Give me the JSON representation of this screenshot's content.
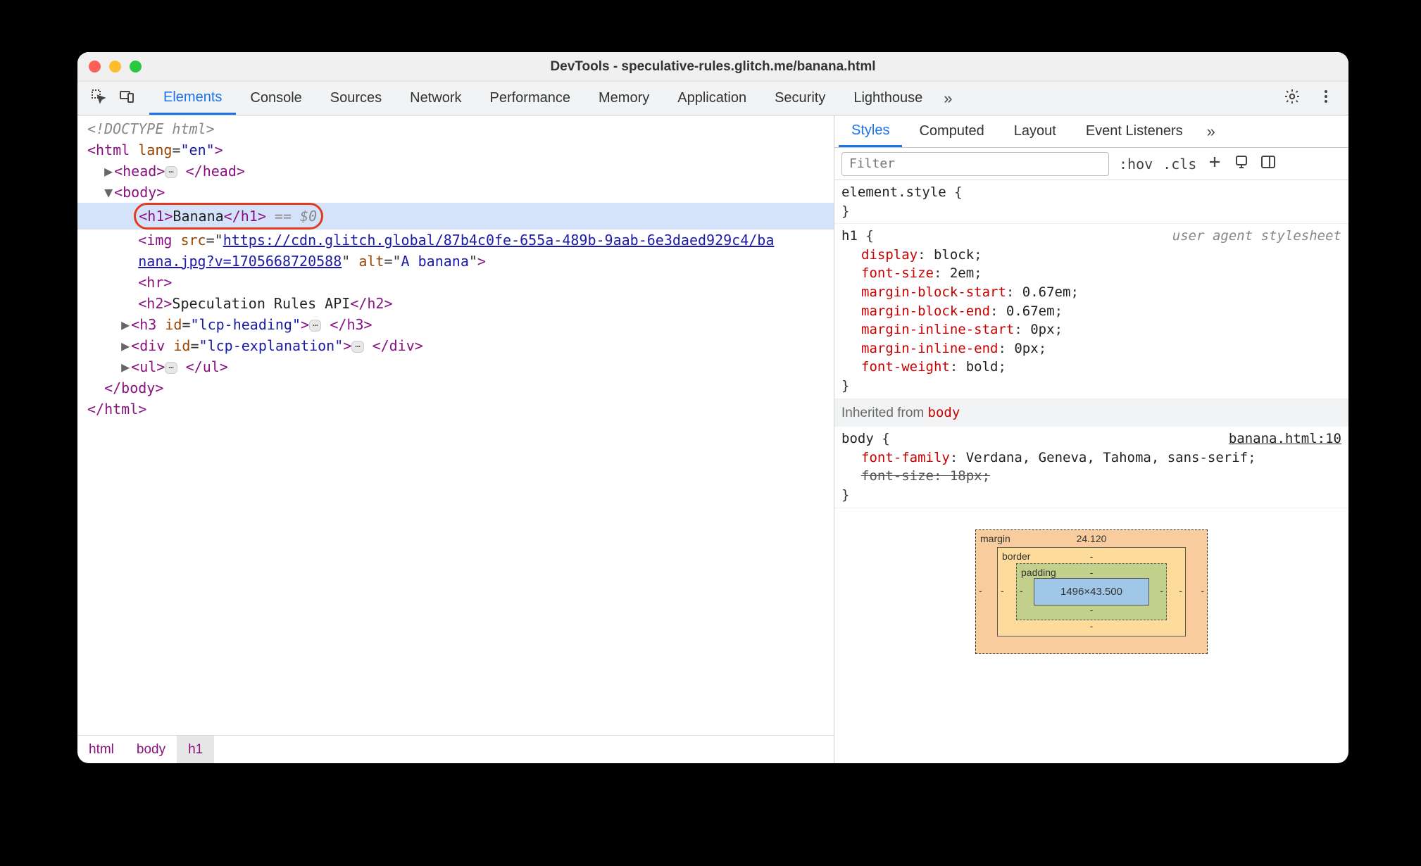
{
  "titlebar": {
    "title": "DevTools - speculative-rules.glitch.me/banana.html"
  },
  "tabs": {
    "main": [
      "Elements",
      "Console",
      "Sources",
      "Network",
      "Performance",
      "Memory",
      "Application",
      "Security",
      "Lighthouse"
    ],
    "activeMain": "Elements",
    "overflow": "»"
  },
  "dom": {
    "doctype": "<!DOCTYPE html>",
    "html_open": "<html lang=\"en\">",
    "head": "<head>",
    "head_close": "</head>",
    "body_open": "<body>",
    "h1_open": "<h1>",
    "h1_text": "Banana",
    "h1_close": "</h1>",
    "selected_hint": " == $0",
    "img_prefix": "<img src=\"",
    "img_src_line1": "https://cdn.glitch.global/87b4c0fe-655a-489b-9aab-6e3daed929c4/ba",
    "img_src_line2": "nana.jpg?v=1705668720588",
    "img_mid": "\" alt=\"",
    "img_alt": "A banana",
    "img_suffix": "\">",
    "hr": "<hr>",
    "h2_open": "<h2>",
    "h2_text": "Speculation Rules API",
    "h2_close": "</h2>",
    "h3_open": "<h3 id=\"lcp-heading\">",
    "h3_close": "</h3>",
    "div_open": "<div id=\"lcp-explanation\">",
    "div_close": "</div>",
    "ul_open": "<ul>",
    "ul_close": "</ul>",
    "body_close": "</body>",
    "html_close": "</html>",
    "ellipsis": "⋯"
  },
  "breadcrumbs": [
    "html",
    "body",
    "h1"
  ],
  "stylesTabs": {
    "items": [
      "Styles",
      "Computed",
      "Layout",
      "Event Listeners"
    ],
    "active": "Styles",
    "overflow": "»"
  },
  "stylesToolbar": {
    "filterPlaceholder": "Filter",
    "hov": ":hov",
    "cls": ".cls"
  },
  "rules": {
    "elementStyle": {
      "selector": "element.style",
      "open": " {",
      "close": "}"
    },
    "h1": {
      "selector": "h1",
      "open": " {",
      "close": "}",
      "note": "user agent stylesheet",
      "decls": [
        {
          "prop": "display",
          "val": "block"
        },
        {
          "prop": "font-size",
          "val": "2em"
        },
        {
          "prop": "margin-block-start",
          "val": "0.67em"
        },
        {
          "prop": "margin-block-end",
          "val": "0.67em"
        },
        {
          "prop": "margin-inline-start",
          "val": "0px"
        },
        {
          "prop": "margin-inline-end",
          "val": "0px"
        },
        {
          "prop": "font-weight",
          "val": "bold"
        }
      ]
    },
    "inheritedLabel": "Inherited from ",
    "inheritedFrom": "body",
    "body": {
      "selector": "body",
      "open": " {",
      "close": "}",
      "srcLink": "banana.html:10",
      "decls": [
        {
          "prop": "font-family",
          "val": "Verdana, Geneva, Tahoma, sans-serif",
          "strike": false
        },
        {
          "prop": "font-size",
          "val": "18px",
          "strike": true
        }
      ]
    }
  },
  "boxModel": {
    "marginLabel": "margin",
    "borderLabel": "border",
    "paddingLabel": "padding",
    "marginTop": "24.120",
    "borderTop": "-",
    "paddingTop": "-",
    "dash": "-",
    "content": "1496×43.500"
  }
}
